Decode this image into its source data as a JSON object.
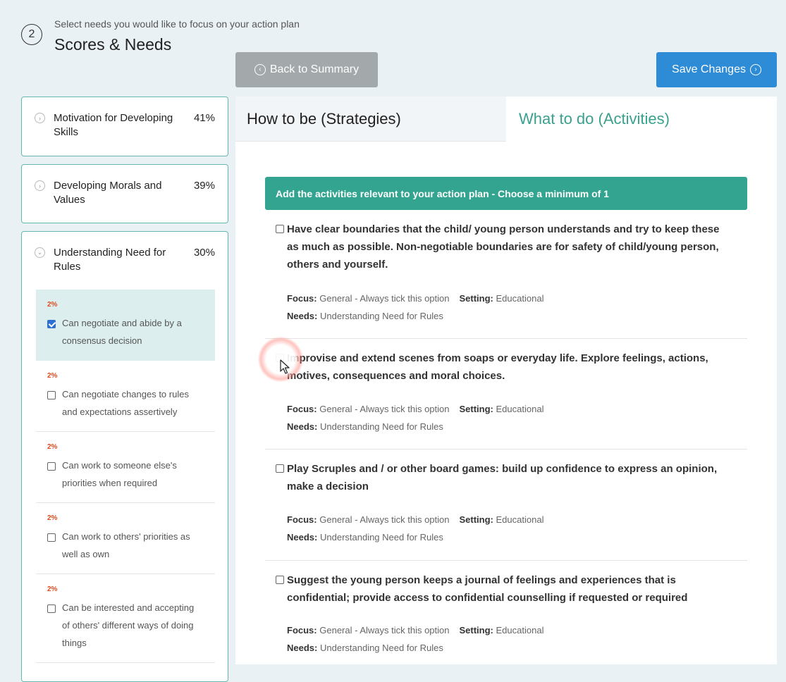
{
  "step": {
    "number": "2",
    "subtitle": "Select needs you would like to focus on your action plan",
    "title": "Scores & Needs"
  },
  "buttons": {
    "back_label": "Back to Summary",
    "save_label": "Save Changes"
  },
  "needs": [
    {
      "name": "Motivation for Developing Skills",
      "percent": "41%",
      "expanded": false
    },
    {
      "name": "Developing Morals and Values",
      "percent": "39%",
      "expanded": false
    },
    {
      "name": "Understanding Need for Rules",
      "percent": "30%",
      "expanded": true,
      "sub_items": [
        {
          "weight": "2%",
          "label": "Can negotiate and abide by a consensus decision",
          "checked": true
        },
        {
          "weight": "2%",
          "label": "Can negotiate changes to rules and expectations assertively",
          "checked": false
        },
        {
          "weight": "2%",
          "label": "Can work to someone else's priorities when required",
          "checked": false
        },
        {
          "weight": "2%",
          "label": "Can work to others' priorities as well as own",
          "checked": false
        },
        {
          "weight": "2%",
          "label": "Can be interested and accepting of others' different ways of doing things",
          "checked": false
        }
      ]
    }
  ],
  "tabs": [
    {
      "label": "How to be (Strategies)",
      "active": false
    },
    {
      "label": "What to do (Activities)",
      "active": true
    }
  ],
  "banner": "Add the activities relevant to your action plan - Choose a minimum of 1",
  "labels": {
    "focus": "Focus:",
    "setting": "Setting:",
    "needs": "Needs:"
  },
  "activities": [
    {
      "title": "Have clear boundaries that the child/ young person understands and try to keep these as much as possible. Non-negotiable boundaries are for safety of child/young person, others and yourself.",
      "focus": "General - Always tick this option",
      "setting": "Educational",
      "needs": "Understanding Need for Rules",
      "checked": false
    },
    {
      "title": "Improvise and extend scenes from soaps or everyday life. Explore feelings, actions, motives, consequences and moral choices.",
      "focus": "General - Always tick this option",
      "setting": "Educational",
      "needs": "Understanding Need for Rules",
      "checked": false
    },
    {
      "title": "Play Scruples and / or other board games: build up confidence to express an opinion, make a decision",
      "focus": "General - Always tick this option",
      "setting": "Educational",
      "needs": "Understanding Need for Rules",
      "checked": false
    },
    {
      "title": "Suggest the young person keeps a journal of feelings and experiences that is confidential; provide access to confidential counselling if requested or required",
      "focus": "General - Always tick this option",
      "setting": "Educational",
      "needs": "Understanding Need for Rules",
      "checked": false
    }
  ],
  "colors": {
    "page_bg": "#eaf1f4",
    "accent_teal": "#33a48f",
    "save_blue": "#2e8bd6",
    "back_gray": "#a3a8ab",
    "weight_red": "#e04a1e"
  }
}
